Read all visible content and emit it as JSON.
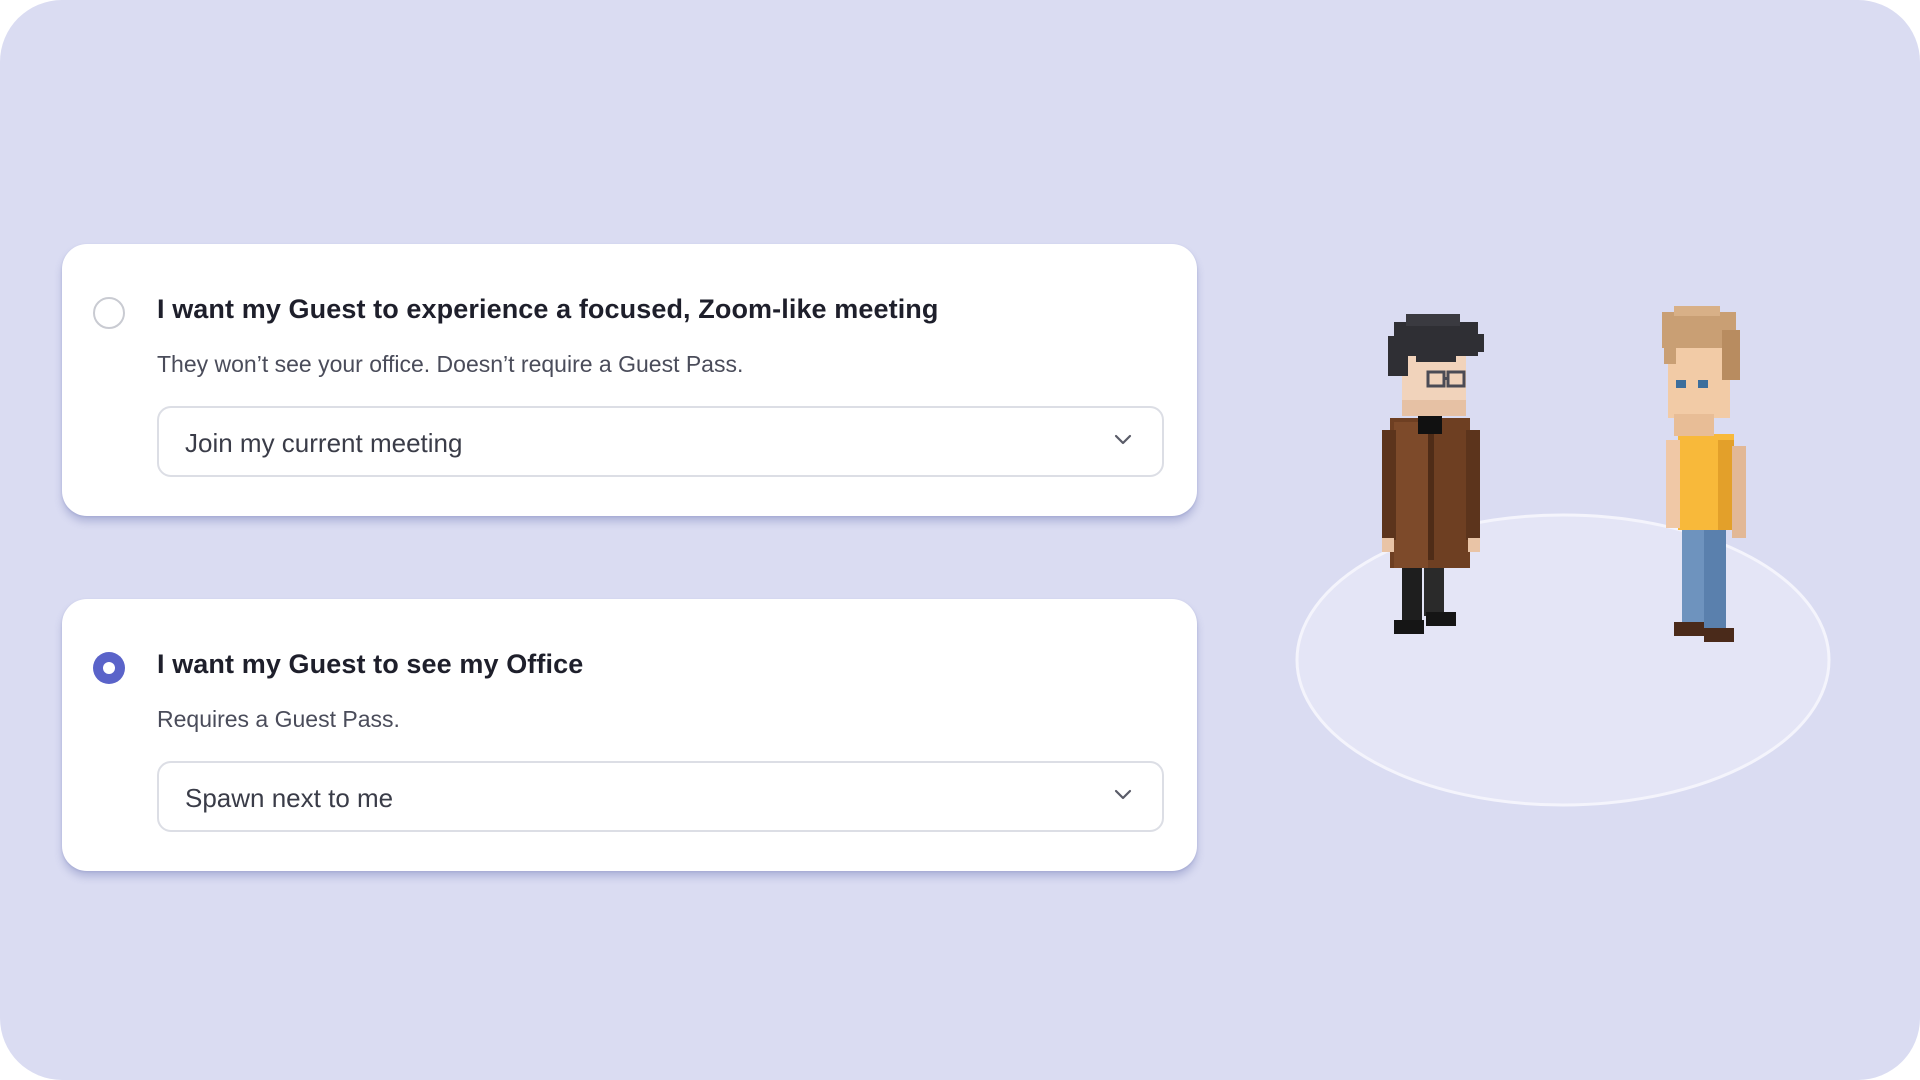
{
  "options": [
    {
      "title": "I want my Guest to experience a focused, Zoom-like meeting",
      "description": "They won’t see your office. Doesn’t require a Guest Pass.",
      "selected": false,
      "dropdown_value": "Join my current meeting"
    },
    {
      "title": "I want my Guest to see my Office",
      "description": "Requires a Guest Pass.",
      "selected": true,
      "dropdown_value": "Spawn next to me"
    }
  ],
  "colors": {
    "background": "#dadcf2",
    "accent": "#5a63c9",
    "card": "#ffffff"
  },
  "icons": {
    "dropdown": "chevron-down-icon",
    "radio_unselected": "radio-unselected-icon",
    "radio_selected": "radio-selected-icon"
  }
}
